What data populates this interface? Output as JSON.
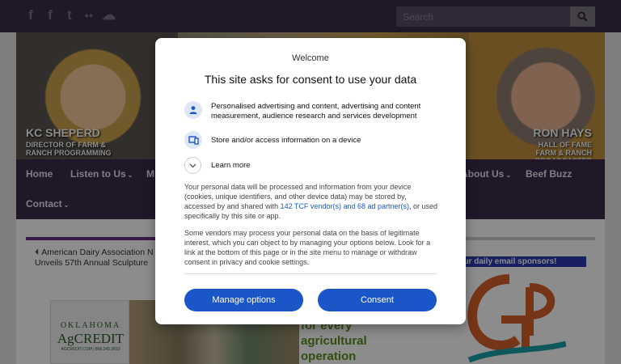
{
  "topbar": {
    "social_icons": [
      "facebook-icon",
      "facebook-icon",
      "twitter-icon",
      "flickr-icon",
      "soundcloud-icon"
    ],
    "social_glyphs": [
      "f",
      "f",
      "t",
      "●●",
      "☁"
    ],
    "search": {
      "placeholder": "Search"
    }
  },
  "banner": {
    "left": {
      "name": "KC SHEPERD",
      "role_line1": "DIRECTOR OF FARM &",
      "role_line2": "RANCH PROGRAMMING"
    },
    "right": {
      "name": "RON HAYS",
      "role_line1": "HALL OF FAME",
      "role_line2": "FARM & RANCH BROADCASTER"
    }
  },
  "nav": {
    "items": [
      {
        "label": "Home",
        "caret": ""
      },
      {
        "label": "Listen to Us",
        "caret": "⌄"
      },
      {
        "label": "M",
        "caret": ""
      },
      {
        "label": "About Us",
        "caret": "⌄"
      },
      {
        "label": "Beef Buzz",
        "caret": ""
      },
      {
        "label": "Contact",
        "caret": "⌄"
      }
    ]
  },
  "content": {
    "news_arrow": "⏴",
    "news_headline": "American Dairy Association N Unveils 57th Annual Sculpture",
    "ad": {
      "brand_line1": "OKLAHOMA",
      "brand_line2": "AgCREDIT",
      "brand_line3": "AGCREDIT.COM | 866.245.3633",
      "tagline_line1": "for every",
      "tagline_line2": "agricultural",
      "tagline_line3": "operation"
    },
    "sponsor_banner": "s our daily email sponsors!"
  },
  "modal": {
    "welcome": "Welcome",
    "title": "This site asks for consent to use your data",
    "purposes": [
      {
        "icon": "person-icon",
        "text": "Personalised advertising and content, advertising and content measurement, audience research and services development"
      },
      {
        "icon": "device-icon",
        "text": "Store and/or access information on a device"
      }
    ],
    "learn_more": "Learn more",
    "paragraph1_before": "Your personal data will be processed and information from your device (cookies, unique identifiers, and other device data) may be stored by, accessed by and shared with ",
    "paragraph1_link": "142 TCF vendor(s) and 68 ad partner(s)",
    "paragraph1_after": ", or used specifically by this site or app.",
    "paragraph2": "Some vendors may process your personal data on the basis of legitimate interest, which you can object to by managing your options below. Look for a link at the bottom of this page or in the site menu to manage or withdraw consent in privacy and cookie settings.",
    "buttons": {
      "manage": "Manage options",
      "consent": "Consent"
    },
    "colors": {
      "primary": "#1a56c8",
      "icon_bg": "#dde7f6"
    }
  },
  "colors": {
    "nav_bg": "#3b2a4b",
    "accent_purple": "#6b2d86",
    "sponsor_blue": "#2d3bb0"
  }
}
